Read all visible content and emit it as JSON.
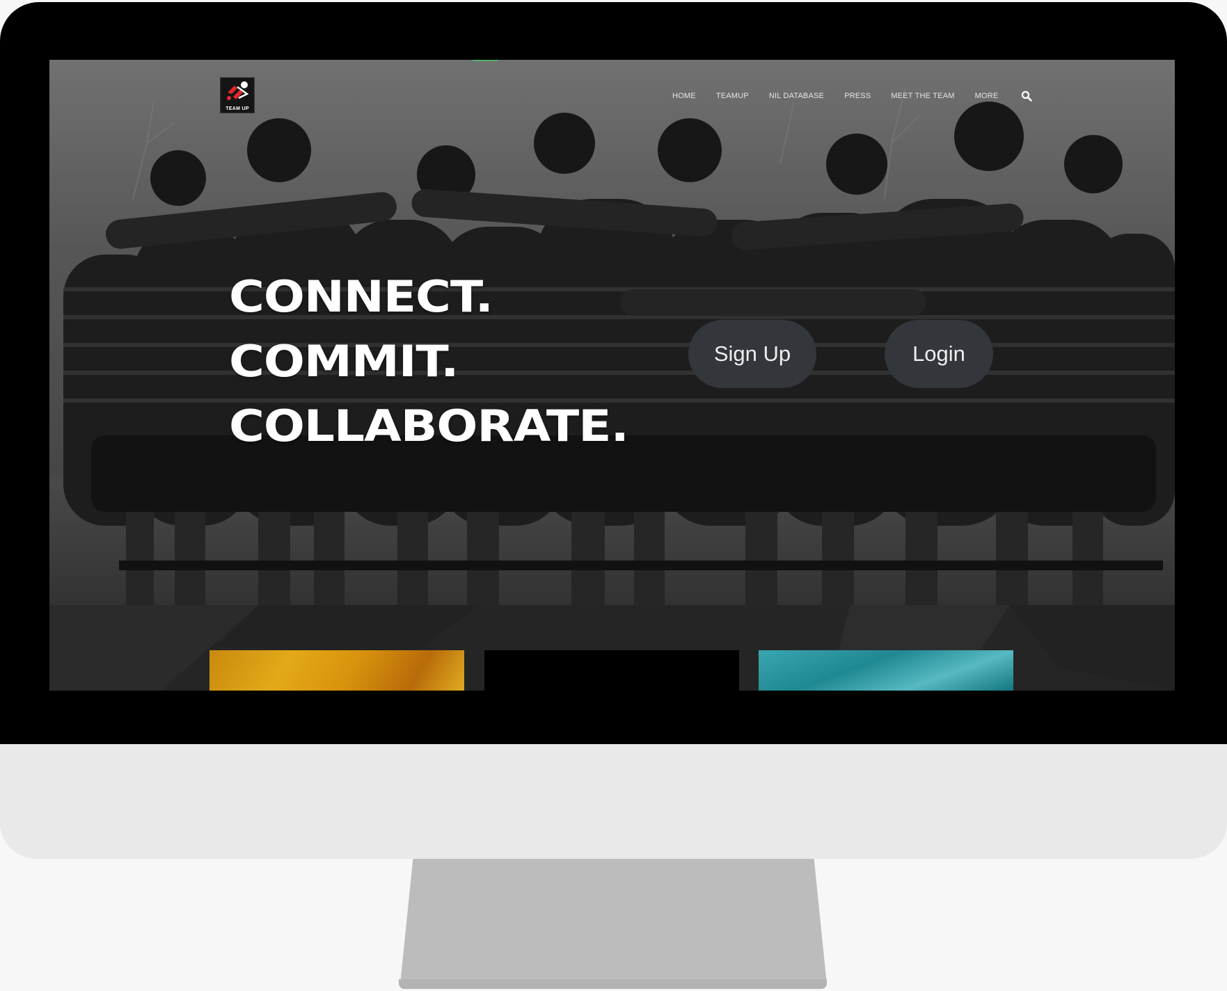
{
  "site": {
    "logo_text": "TEAM UP"
  },
  "nav": {
    "items": [
      "HOME",
      "TEAMUP",
      "NIL DATABASE",
      "PRESS",
      "MEET THE TEAM",
      "MORE"
    ]
  },
  "hero": {
    "headline": [
      "CONNECT.",
      "COMMIT.",
      "COLLABORATE."
    ],
    "signup_label": "Sign Up",
    "login_label": "Login"
  },
  "colors": {
    "button_bg": "#33373b",
    "accent": "#53b26a",
    "logo_red": "#e3262e"
  }
}
